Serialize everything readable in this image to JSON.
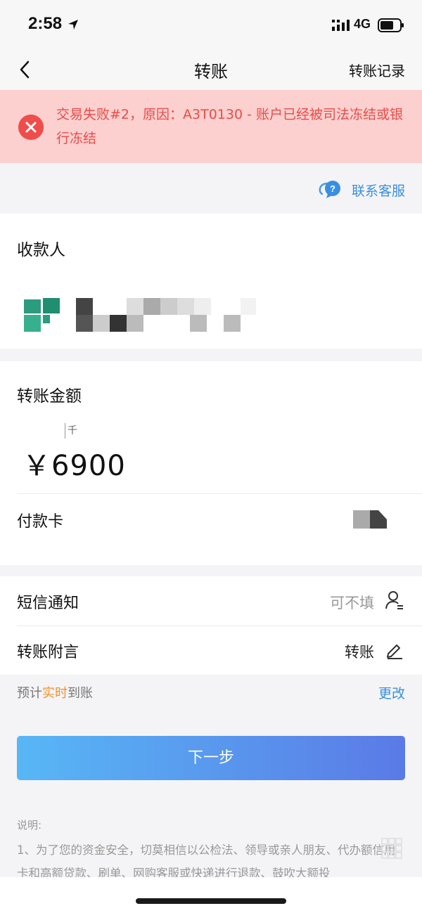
{
  "status_bar": {
    "time": "2:58",
    "network": "4G"
  },
  "nav": {
    "title": "转账",
    "right_link": "转账记录"
  },
  "error_banner": {
    "message": "交易失败#2，原因：A3T0130 - 账户已经被司法冻结或银行冻结"
  },
  "service": {
    "label": "联系客服"
  },
  "payee": {
    "title": "收款人"
  },
  "amount": {
    "title": "转账金额",
    "unit_hint": "千",
    "value": "￥6900"
  },
  "pay_card": {
    "label": "付款卡"
  },
  "sms": {
    "label": "短信通知",
    "placeholder": "可不填"
  },
  "memo": {
    "label": "转账附言",
    "value": "转账"
  },
  "arrival": {
    "prefix": "预计",
    "highlight": "实时",
    "suffix": "到账",
    "change_label": "更改"
  },
  "next_button": {
    "label": "下一步"
  },
  "notes": {
    "title": "说明:",
    "text": "1、为了您的资金安全，切莫相信以公检法、领导或亲人朋友、代办额信用卡和高额贷款、刷单、网购客服或快递进行退款、鼓吹大额投"
  },
  "colors": {
    "error_bg": "#fbd0cf",
    "error_text": "#ea4c48",
    "link_blue": "#3a8ee0",
    "highlight_orange": "#f0922f",
    "button_start": "#58b7f5",
    "button_end": "#5a7ae6"
  },
  "icons": [
    "location-arrow-icon",
    "signal-icon",
    "battery-icon",
    "back-chevron-icon",
    "error-x-icon",
    "chat-bubble-icon",
    "contact-icon",
    "edit-pencil-icon",
    "keypad-icon"
  ]
}
